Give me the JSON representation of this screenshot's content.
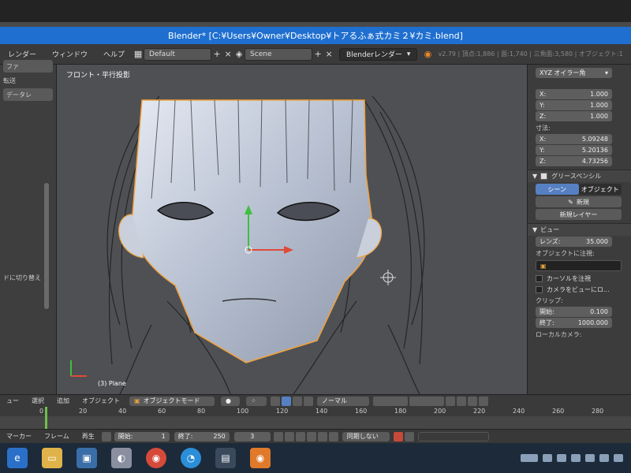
{
  "window": {
    "title": "Blender* [C:¥Users¥Owner¥Desktop¥トアるふぁ式カミ２¥カミ.blend]"
  },
  "infobar": {
    "menus": [
      "レンダー",
      "ウィンドウ",
      "ヘルプ"
    ],
    "layout_value": "Default",
    "scene_value": "Scene",
    "renderer_value": "Blenderレンダー",
    "stats": "v2.79 | 頂点:1,886 | 面:1,740 | 三角面:3,580 | オブジェクト:1"
  },
  "left_panel": {
    "items": [
      "ファ",
      "転送",
      "データレ"
    ],
    "switch_label": "ドに切り替え"
  },
  "viewport": {
    "view_label": "フロント・平行投影",
    "object_label": "(3) Plane"
  },
  "right_panel": {
    "rotation_mode": "XYZ オイラー角",
    "scale": [
      {
        "axis": "X:",
        "value": "1.000"
      },
      {
        "axis": "Y:",
        "value": "1.000"
      },
      {
        "axis": "Z:",
        "value": "1.000"
      }
    ],
    "dimensions_label": "寸法:",
    "dimensions": [
      {
        "axis": "X:",
        "value": "5.09248"
      },
      {
        "axis": "Y:",
        "value": "5.20136"
      },
      {
        "axis": "Z:",
        "value": "4.73256"
      }
    ],
    "grease_pencil": {
      "header": "グリースペンシル",
      "tab_scene": "シーン",
      "tab_object": "オブジェクト",
      "new_button": "新規",
      "new_layer_button": "新規レイヤー"
    },
    "view": {
      "header": "ビュー",
      "lens_label": "レンズ:",
      "lens_value": "35.000",
      "lock_to_object_label": "オブジェクトに注視:",
      "lock_cursor_label": "カーソルを注視",
      "lock_camera_label": "カメラをビューにロ...",
      "clip_label": "クリップ:",
      "clip_start_label": "開始:",
      "clip_start_value": "0.100",
      "clip_end_label": "終了:",
      "clip_end_value": "1000.000",
      "local_camera_label": "ローカルカメラ:"
    }
  },
  "header": {
    "menus": [
      "ュー",
      "選択",
      "追加",
      "オブジェクト"
    ],
    "mode_value": "オブジェクトモード",
    "orientation_value": "ノーマル"
  },
  "timeline": {
    "ticks": [
      "0",
      "20",
      "40",
      "60",
      "80",
      "100",
      "120",
      "140",
      "160",
      "180",
      "200",
      "220",
      "240",
      "260",
      "280"
    ],
    "menus": [
      "マーカー",
      "フレーム",
      "再生"
    ],
    "start_label": "開始:",
    "start_value": "1",
    "end_label": "終了:",
    "end_value": "250",
    "current_value": "3",
    "sync_value": "同期しない"
  },
  "colors": {
    "titlebar": "#1f6fd0",
    "selection_outline": "#f2a23a",
    "active_tab": "#5680c2",
    "timeline_cursor": "#6fbf4b"
  }
}
